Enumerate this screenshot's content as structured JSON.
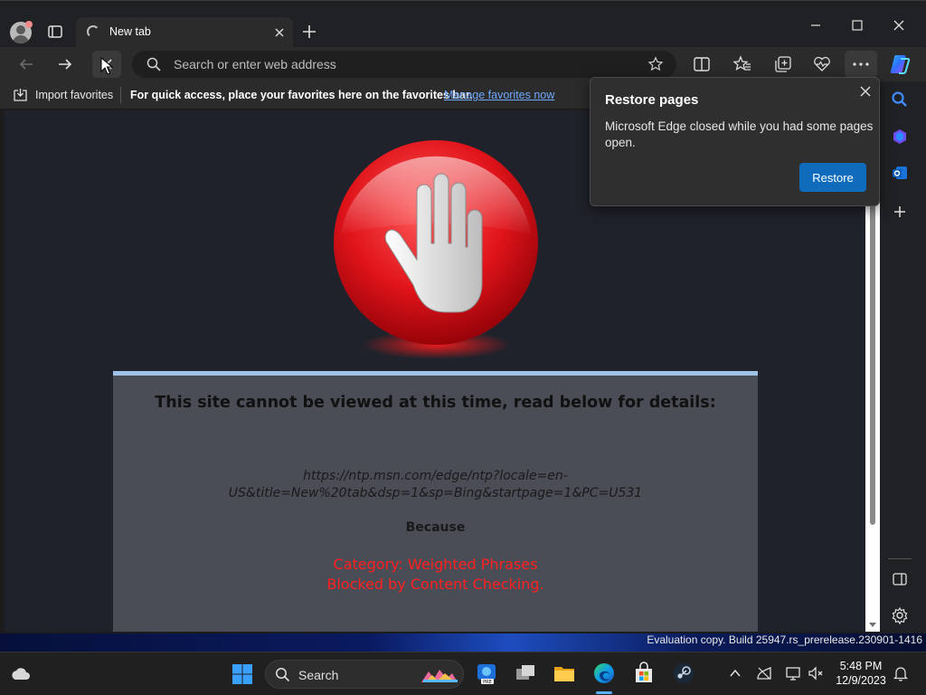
{
  "browser": {
    "tab_title": "New tab",
    "address_placeholder": "Search or enter web address"
  },
  "favorites_bar": {
    "import_label": "Import favorites",
    "hint": "For quick access, place your favorites here on the favorites bar.",
    "manage_link": "Manage favorites now"
  },
  "restore_popup": {
    "title": "Restore pages",
    "message": "Microsoft Edge closed while you had some pages open.",
    "button": "Restore"
  },
  "block_page": {
    "heading": "This site cannot be viewed at this time, read below for details:",
    "url": "https://ntp.msn.com/edge/ntp?locale=en-US&title=New%20tab&dsp=1&sp=Bing&startpage=1&PC=U531",
    "because": "Because",
    "reason_line1": "Category: Weighted Phrases",
    "reason_line2": "Blocked by Content Checking."
  },
  "desktop": {
    "watermark": "Evaluation copy. Build 25947.rs_prerelease.230901-1416"
  },
  "taskbar": {
    "search_label": "Search",
    "time": "5:48 PM",
    "date": "12/9/2023"
  },
  "colors": {
    "accent": "#0f6cbd",
    "link": "#6fa8ff",
    "blocked_reason": "#ff2020",
    "panel_top_border": "#9fc3e7"
  },
  "icons": [
    "profile-icon",
    "tab-actions-icon",
    "spinner-icon",
    "close-icon",
    "plus-icon",
    "minimize-icon",
    "maximize-icon",
    "back-icon",
    "forward-icon",
    "stop-icon",
    "search-icon",
    "star-icon",
    "split-screen-icon",
    "favorites-icon",
    "collections-icon",
    "browser-essentials-icon",
    "more-icon",
    "copilot-icon",
    "import-icon",
    "stop-hand-icon",
    "side-search-icon",
    "side-copilot-icon",
    "outlook-icon",
    "side-add-icon",
    "sidebar-toggle-icon",
    "settings-icon",
    "weather-icon",
    "windows-start-icon",
    "news-icon",
    "task-view-icon",
    "file-explorer-icon",
    "edge-icon",
    "store-icon",
    "steam-icon",
    "chevron-up-icon",
    "network-icon",
    "display-icon",
    "volume-icon",
    "notification-bell-icon"
  ]
}
